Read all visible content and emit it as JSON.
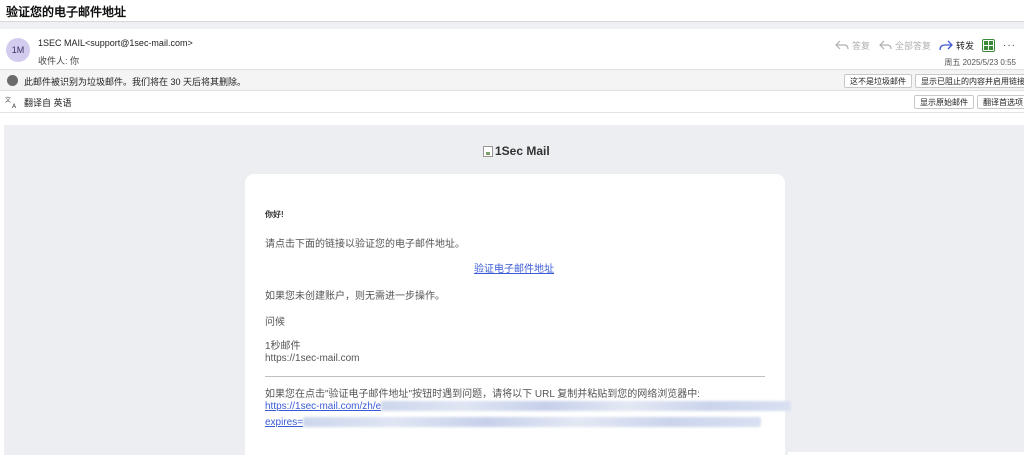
{
  "window": {
    "title": "验证您的电子邮件地址"
  },
  "header": {
    "avatar_initials": "1M",
    "sender": "1SEC MAIL<support@1sec-mail.com>",
    "recipient": "收件人: 你",
    "date": "周五 2025/5/23 0:55",
    "actions": {
      "reply": "答复",
      "reply_all": "全部答复",
      "forward": "转发",
      "more": "···"
    },
    "icons": {
      "reply": "reply-icon",
      "reply_all": "reply-all-icon",
      "forward": "forward-icon",
      "apps": "apps-grid-icon"
    }
  },
  "spam_bar": {
    "message": "此邮件被识别为垃圾邮件。我们将在 30 天后将其删除。",
    "not_spam_button": "这不是垃圾邮件",
    "show_blocked_button": "显示已阻止的内容并启用链接",
    "icon": "info-icon"
  },
  "translate_bar": {
    "message": "翻译自 英语",
    "show_original_button": "显示原始邮件",
    "translate_prefs_button": "翻译首选项",
    "icon": "translate-icon"
  },
  "email": {
    "logo_alt": "1Sec Mail",
    "greeting": "你好!",
    "instruction": "请点击下面的链接以验证您的电子邮件地址。",
    "verify_link": "验证电子邮件地址",
    "no_action": "如果您未创建账户，则无需进一步操作。",
    "regards": "问候",
    "signature_name": "1秒邮件",
    "signature_url": "https://1sec-mail.com",
    "trouble_text": "如果您在点击\"验证电子邮件地址\"按钮时遇到问题，请将以下 URL 复制并粘贴到您的网络浏览器中:",
    "url_prefix": "https://1sec-mail.com/zh/e",
    "expires_prefix": "expires="
  },
  "colors": {
    "link": "#3b5bd6",
    "avatar_bg": "#d4ccef",
    "content_bg": "#eceef2",
    "apps_green": "#3a8a3a"
  }
}
